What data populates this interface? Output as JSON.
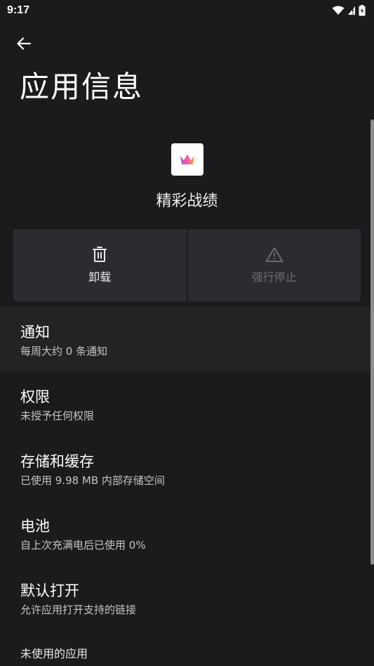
{
  "status_bar": {
    "time": "9:17"
  },
  "header": {
    "title": "应用信息"
  },
  "app": {
    "name": "精彩战绩"
  },
  "actions": {
    "uninstall_label": "卸载",
    "force_stop_label": "强行停止"
  },
  "settings": {
    "items": [
      {
        "title": "通知",
        "subtitle": "每周大约 0 条通知"
      },
      {
        "title": "权限",
        "subtitle": "未授予任何权限"
      },
      {
        "title": "存储和缓存",
        "subtitle": "已使用 9.98 MB 内部存储空间"
      },
      {
        "title": "电池",
        "subtitle": "自上次充满电后已使用 0%"
      },
      {
        "title": "默认打开",
        "subtitle": "允许应用打开支持的链接"
      }
    ],
    "partial_item": "未使用的应用"
  },
  "colors": {
    "background": "#1b1b1d",
    "button_bg": "#2b2c31",
    "highlight_bg": "#232326",
    "disabled_text": "#6b6c70"
  },
  "icons": {
    "back": "arrow-left-icon",
    "uninstall": "trash-icon",
    "force_stop": "warning-icon",
    "app": "crown-icon"
  }
}
